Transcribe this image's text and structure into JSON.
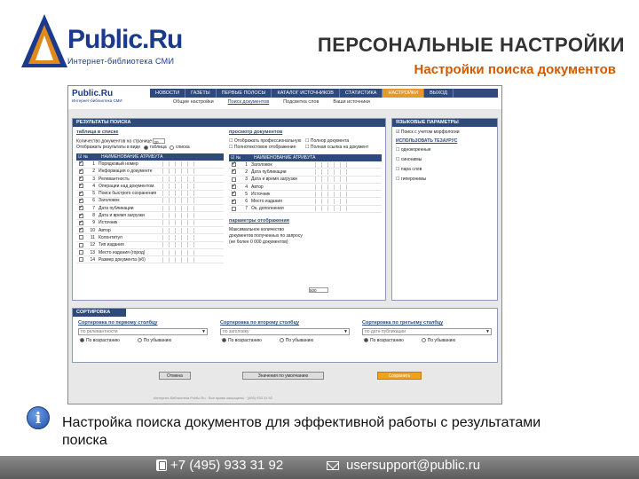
{
  "header": {
    "logo_word": "Public.Ru",
    "logo_tagline": "Интернет-библиотека СМИ",
    "title": "ПЕРСОНАЛЬНЫЕ НАСТРОЙКИ",
    "subtitle": "Настройки поиска документов"
  },
  "screenshot": {
    "mini_logo": "Public.Ru",
    "mini_tagline": "Интернет-библиотека СМИ",
    "nav": [
      "НОВОСТИ",
      "ГАЗЕТЫ",
      "ПЕРВЫЕ ПОЛОСЫ",
      "КАТАЛОГ ИСТОЧНИКОВ",
      "СТАТИСТИКА",
      "НАСТРОЙКИ",
      "ВЫХОД"
    ],
    "nav_active": "НАСТРОЙКИ",
    "subnav": [
      "Общие настройки",
      "Поиск документов",
      "Подсветка слов",
      "Ваши источники"
    ],
    "results_panel": {
      "header": "РЕЗУЛЬТАТЫ ПОИСКА",
      "list_group": "таблица в списке",
      "docs_per_page_label": "Количество документов на странице",
      "docs_per_page_value": "20",
      "show_as_label": "Отображать результаты в виде",
      "show_options": [
        "таблица",
        "списка"
      ],
      "col_header": "НАИМЕНОВАНИЕ АТРИБУТА",
      "attributes": [
        {
          "n": "1",
          "label": "Порядковый номер",
          "on": true
        },
        {
          "n": "2",
          "label": "Информация о документе",
          "on": true
        },
        {
          "n": "3",
          "label": "Релевантность",
          "on": true
        },
        {
          "n": "4",
          "label": "Операции над документом",
          "on": true
        },
        {
          "n": "5",
          "label": "Поиск быстрого сохранения",
          "on": true
        },
        {
          "n": "6",
          "label": "Заголовок",
          "on": true
        },
        {
          "n": "7",
          "label": "Дата публикации",
          "on": true
        },
        {
          "n": "8",
          "label": "Дата и время загрузки",
          "on": true
        },
        {
          "n": "9",
          "label": "Источник",
          "on": true
        },
        {
          "n": "10",
          "label": "Автор",
          "on": true
        },
        {
          "n": "11",
          "label": "Колонтитул",
          "on": false
        },
        {
          "n": "12",
          "label": "Тип издания",
          "on": false
        },
        {
          "n": "13",
          "label": "Место издания (город)",
          "on": false
        },
        {
          "n": "14",
          "label": "Размер документа (кб)",
          "on": false
        }
      ],
      "docview_group": "просмотр документов",
      "docview_opts": [
        "Отображать профессиональную",
        "Полнотекстовое отображение",
        "Полнор документа",
        "Полная ссылка на документ"
      ],
      "doc_attributes": [
        {
          "n": "1",
          "label": "Заголовок",
          "on": true
        },
        {
          "n": "2",
          "label": "Дата публикации",
          "on": true
        },
        {
          "n": "3",
          "label": "Дата и время загрузки",
          "on": false
        },
        {
          "n": "4",
          "label": "Автор",
          "on": true
        },
        {
          "n": "5",
          "label": "Источник",
          "on": true
        },
        {
          "n": "6",
          "label": "Место издания",
          "on": true
        },
        {
          "n": "7",
          "label": "Ок, дополнения",
          "on": false
        }
      ],
      "display_group": "параметры отображения",
      "display_text": "Максимальное количество документов полученных по запросу (не более 0 000 документов)",
      "display_value": "500"
    },
    "lang_panel": {
      "header": "ЯЗЫКОВЫЕ ПАРАМЕТРЫ",
      "morph_label": "Поиск с учетом морфологии",
      "thesaurus_label": "ИСПОЛЬЗОВАТЬ ТЕЗАУРУС",
      "options": [
        "однокоренные",
        "синонимы",
        "пара слов",
        "гиперонимы"
      ]
    },
    "sort_panel": {
      "header": "СОРТИРОВКА",
      "columns": [
        {
          "title": "Сортировка по первому столбцу",
          "select": "по релевантности",
          "asc": "По возрастанию",
          "desc": "По убыванию"
        },
        {
          "title": "Сортировка по второму столбцу",
          "select": "по заголовку",
          "asc": "По возрастанию",
          "desc": "По убыванию"
        },
        {
          "title": "Сортировка по третьему столбцу",
          "select": "по дате публикации",
          "asc": "По возрастанию",
          "desc": "По убыванию"
        }
      ]
    },
    "buttons": {
      "cancel": "Отмена",
      "default": "Значения по умолчанию",
      "save": "Сохранить"
    },
    "footer": "Интернет-библиотека Public.Ru · Все права защищены · (495) 933 31 92"
  },
  "caption": "Настройка поиска документов для эффективной работы с результатами поиска",
  "contacts": {
    "phone": "+7 (495) 933 31 92",
    "email": "usersupport@public.ru"
  },
  "colors": {
    "brand_blue": "#1b3a8c",
    "accent_orange": "#d25a00",
    "panel_header": "#2e4a7a"
  }
}
